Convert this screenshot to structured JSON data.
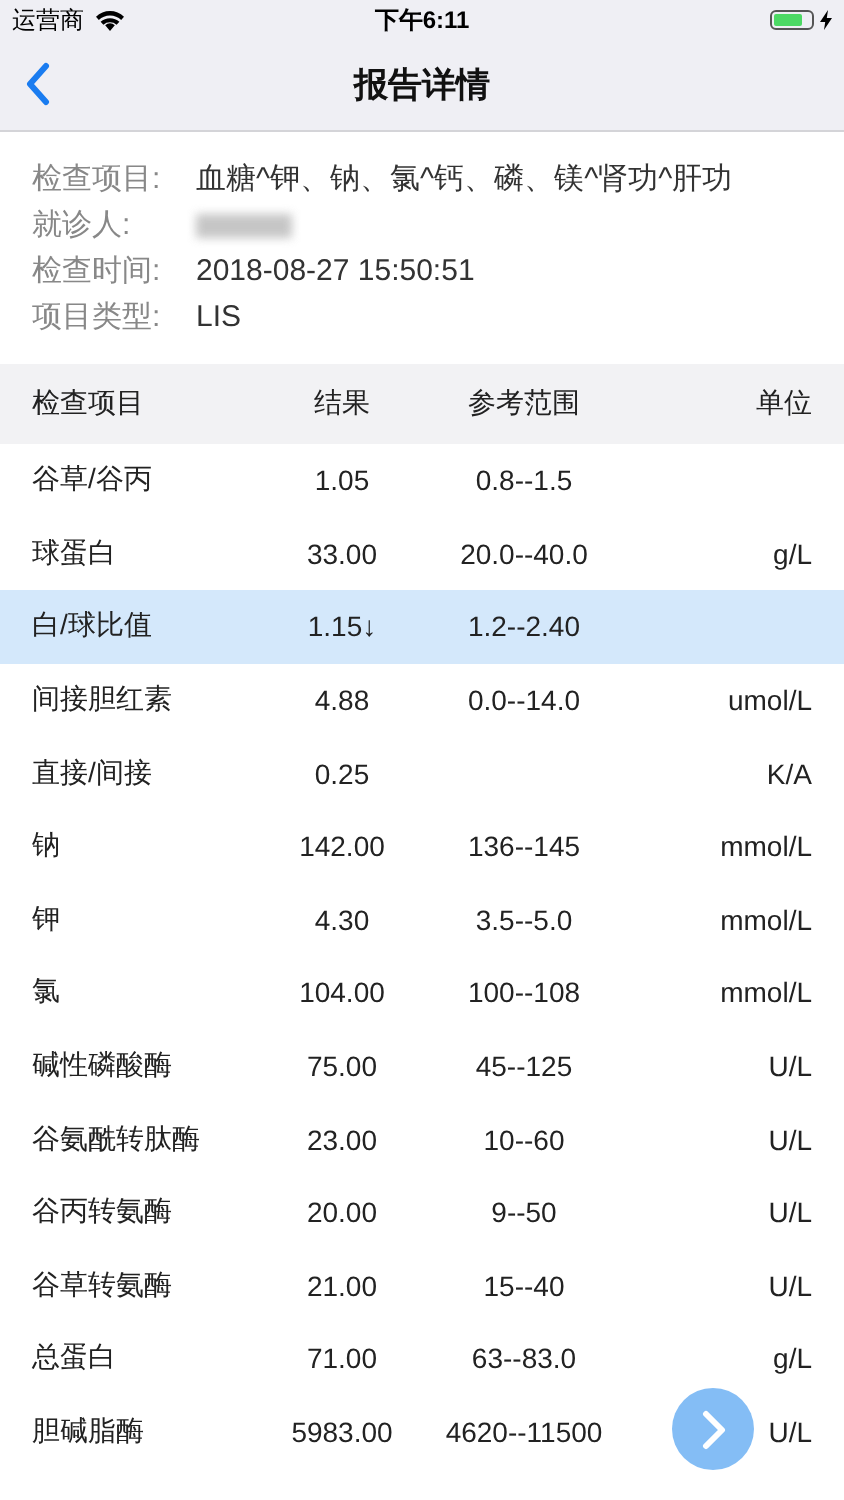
{
  "status_bar": {
    "carrier": "运营商",
    "time": "下午6:11",
    "charging": true
  },
  "nav": {
    "title": "报告详情"
  },
  "info": [
    {
      "label": "检查项目:",
      "value": "血糖^钾、钠、氯^钙、磷、镁^肾功^肝功"
    },
    {
      "label": "就诊人:",
      "redacted": true
    },
    {
      "label": "检查时间:",
      "value": "2018-08-27 15:50:51"
    },
    {
      "label": "项目类型:",
      "value": "LIS"
    }
  ],
  "table": {
    "columns": [
      "检查项目",
      "结果",
      "参考范围",
      "单位"
    ],
    "rows": [
      {
        "cells": [
          "谷草/谷丙",
          "1.05",
          "0.8--1.5",
          ""
        ],
        "flagged": false
      },
      {
        "cells": [
          "球蛋白",
          "33.00",
          "20.0--40.0",
          "g/L"
        ],
        "flagged": false
      },
      {
        "cells": [
          "白/球比值",
          "1.15↓",
          "1.2--2.40",
          ""
        ],
        "flagged": true
      },
      {
        "cells": [
          "间接胆红素",
          "4.88",
          "0.0--14.0",
          "umol/L"
        ],
        "flagged": false
      },
      {
        "cells": [
          "直接/间接",
          "0.25",
          "",
          "K/A"
        ],
        "flagged": false
      },
      {
        "cells": [
          "钠",
          "142.00",
          "136--145",
          "mmol/L"
        ],
        "flagged": false
      },
      {
        "cells": [
          "钾",
          "4.30",
          "3.5--5.0",
          "mmol/L"
        ],
        "flagged": false
      },
      {
        "cells": [
          "氯",
          "104.00",
          "100--108",
          "mmol/L"
        ],
        "flagged": false
      },
      {
        "cells": [
          "碱性磷酸酶",
          "75.00",
          "45--125",
          "U/L"
        ],
        "flagged": false
      },
      {
        "cells": [
          "谷氨酰转肽酶",
          "23.00",
          "10--60",
          "U/L"
        ],
        "flagged": false
      },
      {
        "cells": [
          "谷丙转氨酶",
          "20.00",
          "9--50",
          "U/L"
        ],
        "flagged": false
      },
      {
        "cells": [
          "谷草转氨酶",
          "21.00",
          "15--40",
          "U/L"
        ],
        "flagged": false
      },
      {
        "cells": [
          "总蛋白",
          "71.00",
          "63--83.0",
          "g/L"
        ],
        "flagged": false
      },
      {
        "cells": [
          "胆碱脂酶",
          "5983.00",
          "4620--11500",
          "U/L"
        ],
        "flagged": false
      }
    ]
  },
  "floating_button": {
    "visible": true
  }
}
